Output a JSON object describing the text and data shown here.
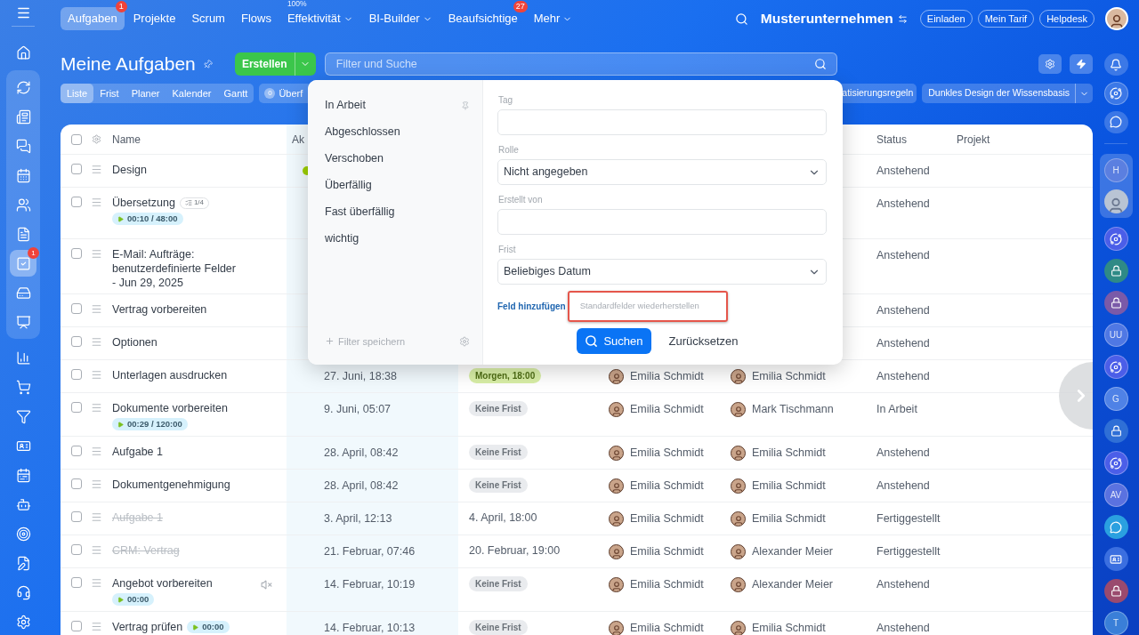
{
  "top_nav": {
    "items": [
      {
        "label": "Aufgaben",
        "selected": true,
        "badge": "1",
        "dropdown": false
      },
      {
        "label": "Projekte",
        "selected": false,
        "dropdown": false
      },
      {
        "label": "Scrum",
        "selected": false,
        "dropdown": false
      },
      {
        "label": "Flows",
        "selected": false,
        "dropdown": false
      },
      {
        "label": "Effektivität",
        "selected": false,
        "dropdown": true,
        "above": "100%"
      },
      {
        "label": "BI-Builder",
        "selected": false,
        "dropdown": true
      },
      {
        "label": "Beaufsichtige",
        "selected": false,
        "badge": "27",
        "dropdown": false
      },
      {
        "label": "Mehr",
        "selected": false,
        "dropdown": true
      }
    ],
    "company": "Musterunternehmen",
    "buttons": [
      "Einladen",
      "Mein Tarif",
      "Helpdesk"
    ]
  },
  "left_sidebar": {
    "top": [
      {
        "selected": false
      }
    ],
    "group": [
      {
        "selected": false
      },
      {
        "selected": false
      },
      {
        "selected": false
      },
      {
        "selected": false
      },
      {
        "selected": false
      },
      {
        "selected": false
      },
      {
        "selected": true,
        "badge": "1"
      },
      {
        "selected": false
      },
      {
        "selected": false
      }
    ],
    "bottom": [
      {
        "selected": false
      },
      {
        "selected": false
      },
      {
        "selected": false
      },
      {
        "selected": false
      },
      {
        "selected": false
      },
      {
        "selected": false
      },
      {
        "selected": false
      },
      {
        "selected": false
      },
      {
        "selected": false
      },
      {
        "selected": false
      }
    ]
  },
  "header": {
    "title": "Meine Aufgaben",
    "create_button": "Erstellen",
    "search": {
      "placeholder": "Filter und Suche"
    }
  },
  "toolbar": {
    "views": [
      {
        "label": "Liste",
        "selected": true
      },
      {
        "label": "Frist",
        "selected": false
      },
      {
        "label": "Planer",
        "selected": false
      },
      {
        "label": "Kalender",
        "selected": false
      },
      {
        "label": "Gantt",
        "selected": false
      }
    ],
    "counter": {
      "count": "0",
      "label": "Überf"
    },
    "rules_chip": "atisierungsregeln",
    "theme_button": "Dunkles Design der Wissensbasis"
  },
  "table": {
    "header": {
      "select_all_checked": false,
      "name": "Name",
      "activity": "Ak",
      "status": "Status",
      "project": "Projekt"
    },
    "rows": [
      {
        "name": "Design",
        "checked": false,
        "completed": false,
        "muted": false,
        "activity_dot": true,
        "status": "Anstehend"
      },
      {
        "name": "Übersetzung",
        "checked": false,
        "completed": false,
        "muted": false,
        "checklist": "1/4",
        "timer": "00:10 / 48:00",
        "activity_dot": false,
        "status": "Anstehend"
      },
      {
        "name": "E-Mail: Aufträge: benutzerdefinierte Felder - Jun 29, 2025",
        "checked": false,
        "completed": false,
        "muted": false,
        "activity_dot": false,
        "status": "Anstehend"
      },
      {
        "name": "Vertrag vorbereiten",
        "checked": false,
        "completed": false,
        "muted": false,
        "activity_dot": false,
        "status": "Anstehend"
      },
      {
        "name": "Optionen",
        "checked": false,
        "completed": false,
        "muted": false,
        "activity_dot": false,
        "status": "Anstehend"
      },
      {
        "name": "Unterlagen ausdrucken",
        "checked": false,
        "completed": false,
        "muted": false,
        "activity_dot": false,
        "activity": "27. Juni, 18:38",
        "deadline": {
          "kind": "soon",
          "text": "Morgen, 18:00"
        },
        "creator": "Emilia Schmidt",
        "responsible": "Emilia Schmidt",
        "status": "Anstehend"
      },
      {
        "name": "Dokumente vorbereiten",
        "checked": false,
        "completed": false,
        "muted": false,
        "timer": "00:29 / 120:00",
        "activity_dot": false,
        "activity": "9. Juni, 05:07",
        "deadline": {
          "kind": "none",
          "text": "Keine Frist"
        },
        "creator": "Emilia Schmidt",
        "responsible": "Mark Tischmann",
        "status": "In Arbeit"
      },
      {
        "name": "Aufgabe 1",
        "checked": false,
        "completed": false,
        "muted": false,
        "activity_dot": false,
        "activity": "28. April, 08:42",
        "deadline": {
          "kind": "none",
          "text": "Keine Frist"
        },
        "creator": "Emilia Schmidt",
        "responsible": "Emilia Schmidt",
        "status": "Anstehend"
      },
      {
        "name": "Dokumentgenehmigung",
        "checked": false,
        "completed": false,
        "muted": false,
        "activity_dot": false,
        "activity": "28. April, 08:42",
        "deadline": {
          "kind": "none",
          "text": "Keine Frist"
        },
        "creator": "Emilia Schmidt",
        "responsible": "Emilia Schmidt",
        "status": "Anstehend"
      },
      {
        "name": "Aufgabe 1",
        "checked": false,
        "completed": true,
        "muted": false,
        "activity_dot": false,
        "activity": "3. April, 12:13",
        "deadline": {
          "kind": "date",
          "text": "4. April, 18:00"
        },
        "creator": "Emilia Schmidt",
        "responsible": "Emilia Schmidt",
        "status": "Fertiggestellt"
      },
      {
        "name": "CRM: Vertrag",
        "checked": false,
        "completed": true,
        "muted": false,
        "activity_dot": false,
        "activity": "21. Februar, 07:46",
        "deadline": {
          "kind": "date",
          "text": "20. Februar, 19:00"
        },
        "creator": "Emilia Schmidt",
        "responsible": "Alexander Meier",
        "status": "Fertiggestellt"
      },
      {
        "name": "Angebot vorbereiten",
        "checked": false,
        "completed": false,
        "muted": true,
        "timer": "00:00",
        "activity_dot": false,
        "activity": "14. Februar, 10:19",
        "deadline": {
          "kind": "none",
          "text": "Keine Frist"
        },
        "creator": "Emilia Schmidt",
        "responsible": "Alexander Meier",
        "status": "Anstehend"
      },
      {
        "name": "Vertrag prüfen",
        "checked": false,
        "completed": false,
        "muted": false,
        "inline_timer": "00:00",
        "activity_dot": false,
        "activity": "14. Februar, 10:13",
        "deadline": {
          "kind": "none",
          "text": "Keine Frist"
        },
        "creator": "Emilia Schmidt",
        "responsible": "Emilia Schmidt",
        "status": "Anstehend"
      }
    ]
  },
  "filter_popup": {
    "presets": [
      {
        "label": "In Arbeit",
        "pinned": true
      },
      {
        "label": "Abgeschlossen",
        "pinned": false
      },
      {
        "label": "Verschoben",
        "pinned": false
      },
      {
        "label": "Überfällig",
        "pinned": false
      },
      {
        "label": "Fast überfällig",
        "pinned": false
      },
      {
        "label": "wichtig",
        "pinned": false
      }
    ],
    "save_filter": "Filter speichern",
    "fields": [
      {
        "label": "Tag",
        "kind": "text"
      },
      {
        "label": "Rolle",
        "kind": "select",
        "value": "Nicht angegeben"
      },
      {
        "label": "Erstellt von",
        "kind": "text"
      },
      {
        "label": "Frist",
        "kind": "select",
        "value": "Beliebiges Datum"
      }
    ],
    "add_field": "Feld hinzufügen",
    "restore_fields": "Standardfelder wiederherstellen",
    "search_button": "Suchen",
    "reset_button": "Zurücksetzen"
  },
  "right_sidebar": {
    "top": [
      {
        "kind": "bell"
      },
      {
        "kind": "spiral"
      },
      {
        "kind": "chat"
      }
    ],
    "group": [
      {
        "kind": "letter",
        "text": "H",
        "color": "#5b7fe0"
      },
      {
        "kind": "photo"
      }
    ],
    "items": [
      {
        "kind": "spiral",
        "color": "#4b5ee8"
      },
      {
        "kind": "lock",
        "color": "#2f8a86"
      },
      {
        "kind": "lock",
        "color": "#7a5aa8"
      },
      {
        "kind": "letter",
        "text": "UU",
        "color": "#4f78e4"
      },
      {
        "kind": "spiral",
        "color": "#4b5ee8"
      },
      {
        "kind": "letter",
        "text": "G",
        "color": "#4f82e6"
      },
      {
        "kind": "lock",
        "color": "#2f6fd6"
      },
      {
        "kind": "spiral",
        "color": "#4b5ee8"
      },
      {
        "kind": "letter",
        "text": "AV",
        "color": "#5a72e0"
      },
      {
        "kind": "chat",
        "color": "#2aa0e0"
      },
      {
        "kind": "card",
        "color": "#3b6fe0"
      },
      {
        "kind": "lock",
        "color": "#9a4a6e"
      },
      {
        "kind": "letter",
        "text": "T",
        "color": "#3a7fd8"
      }
    ]
  }
}
